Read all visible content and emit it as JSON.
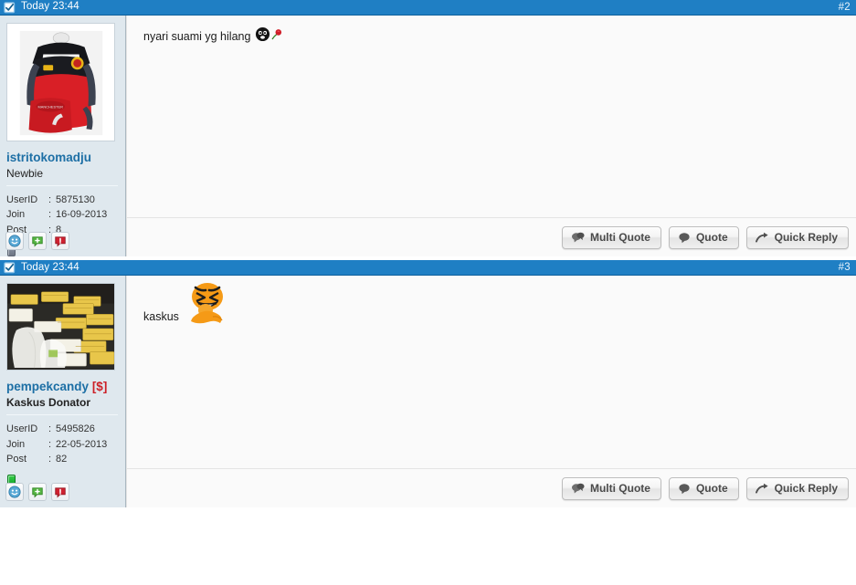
{
  "posts": [
    {
      "timestamp": "Today 23:44",
      "number": "#2",
      "checkbox_icon": "checked-checkbox-icon",
      "user": {
        "name": "istritokomadju",
        "donor_badge": "",
        "rank": "Newbie",
        "rank_bold": false,
        "avatar_alt": "red and black backpack product photo",
        "stats": [
          {
            "key": "UserID",
            "sep": ":",
            "value": "5875130"
          },
          {
            "key": "Join",
            "sep": ":",
            "value": "16-09-2013"
          },
          {
            "key": "Post",
            "sep": ":",
            "value": "8"
          }
        ],
        "status": "offline"
      },
      "message": "nyari suami yg hilang",
      "emoticons": [
        "dark-face-emoticon",
        "rose-emoticon"
      ],
      "buttons": [
        {
          "label": "Multi Quote",
          "icon": "multi-quote-icon"
        },
        {
          "label": "Quote",
          "icon": "quote-icon"
        },
        {
          "label": "Quick Reply",
          "icon": "quick-reply-arrow-icon"
        }
      ],
      "user_icons": [
        "profile-smiley-icon",
        "add-reputation-icon",
        "report-post-icon"
      ]
    },
    {
      "timestamp": "Today 23:44",
      "number": "#3",
      "checkbox_icon": "checked-checkbox-icon",
      "user": {
        "name": "pempekcandy",
        "donor_badge": "[$]",
        "rank": "Kaskus Donator",
        "rank_bold": true,
        "avatar_alt": "yellow boxes and white plastic bags product photo",
        "stats": [
          {
            "key": "UserID",
            "sep": ":",
            "value": "5495826"
          },
          {
            "key": "Join",
            "sep": ":",
            "value": "22-05-2013"
          },
          {
            "key": "Post",
            "sep": ":",
            "value": "82"
          }
        ],
        "status": "online"
      },
      "message": "kaskus",
      "emoticons": [
        "orange-laughing-emoticon"
      ],
      "buttons": [
        {
          "label": "Multi Quote",
          "icon": "multi-quote-icon"
        },
        {
          "label": "Quote",
          "icon": "quote-icon"
        },
        {
          "label": "Quick Reply",
          "icon": "quick-reply-arrow-icon"
        }
      ],
      "user_icons": [
        "profile-smiley-icon",
        "add-reputation-icon",
        "report-post-icon"
      ]
    }
  ],
  "colors": {
    "header_blue": "#1f7fc4",
    "username_blue": "#1d6fa5",
    "donor_red": "#cc2027",
    "sidebar_bg": "#dfe8ee",
    "online_green": "#11a32a"
  }
}
